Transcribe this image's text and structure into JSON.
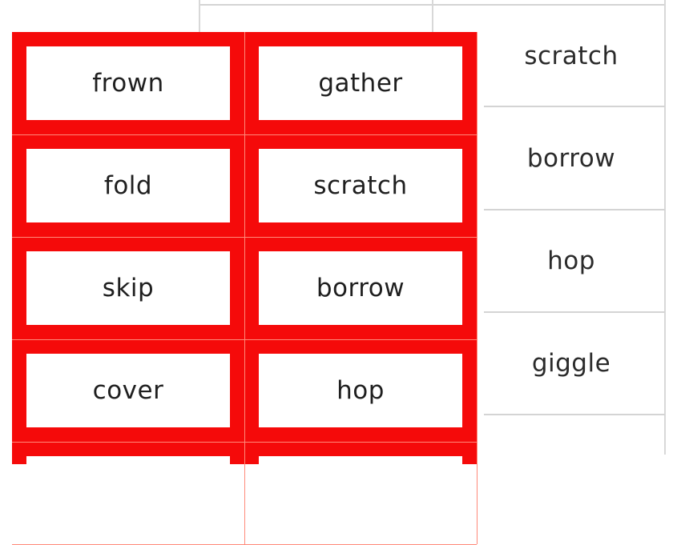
{
  "colors": {
    "card_border": "#f50a0a",
    "card_fill": "#ffffff",
    "text": "#1f1f1f",
    "table_lines": "#d4d4d4"
  },
  "cards": {
    "rows": [
      [
        "frown",
        "gather"
      ],
      [
        "fold",
        "scratch"
      ],
      [
        "skip",
        "borrow"
      ],
      [
        "cover",
        "hop"
      ],
      [
        "",
        ""
      ]
    ]
  },
  "word_list": {
    "items": [
      "scratch",
      "borrow",
      "hop",
      "giggle",
      ""
    ]
  }
}
